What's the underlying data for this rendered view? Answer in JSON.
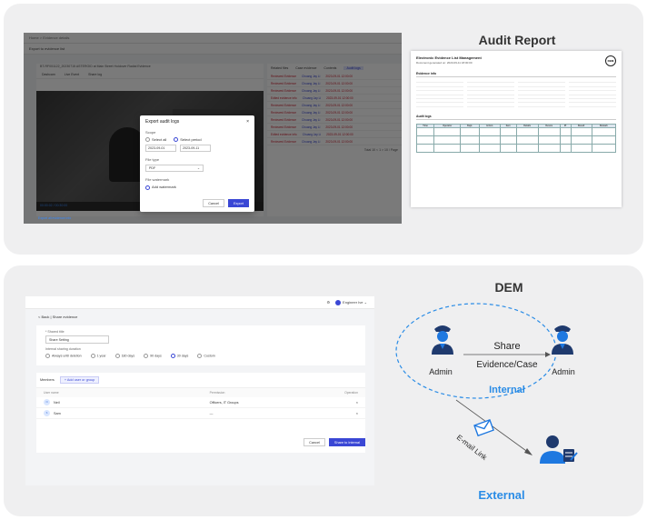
{
  "audit_app": {
    "breadcrumb": "Home > Evidence details",
    "evidence_title": "Export to evidence list",
    "evidence_line": "BT-RF001122_20230715 ASTEROID at Main Street Holdover Radial Evidence",
    "tabs": [
      "Dashcam",
      "Live Event",
      "Share log"
    ],
    "right_tabs": [
      "Related files",
      "Case evidence",
      "Contents",
      "Audit logs"
    ],
    "rows": [
      {
        "name": "Reviewed Evidence",
        "user": "Chuang Jay Li",
        "date": "2023-09-01 12:00:00"
      },
      {
        "name": "Reviewed Evidence",
        "user": "Chuang Jay Li",
        "date": "2023-09-01 12:00:00"
      },
      {
        "name": "Reviewed Evidence",
        "user": "Chuang Jay Li",
        "date": "2023-09-01 12:00:00"
      },
      {
        "name": "Edited evidence info",
        "user": "Chuang Jay Li",
        "date": "2023-09-01 12:00:00"
      },
      {
        "name": "Reviewed Evidence",
        "user": "Chuang Jay Li",
        "date": "2023-09-01 12:00:00"
      },
      {
        "name": "Reviewed Evidence",
        "user": "Chuang Jay Li",
        "date": "2023-09-01 12:00:00"
      },
      {
        "name": "Reviewed Evidence",
        "user": "Chuang Jay Li",
        "date": "2023-09-01 12:00:00"
      },
      {
        "name": "Reviewed Evidence",
        "user": "Chuang Jay Li",
        "date": "2023-09-01 12:00:00"
      },
      {
        "name": "Edited evidence info",
        "user": "Chuang Jay Li",
        "date": "2023-09-01 12:00:00"
      },
      {
        "name": "Reviewed Evidence",
        "user": "Chuang Jay Li",
        "date": "2023-09-01 12:00:00"
      }
    ],
    "pager": "Total 10  < 1 >  10 / Page",
    "video_time": "00:00:02 / 00:30:00",
    "bottom_link": "Export all evidence info",
    "modal": {
      "title": "Export audit logs",
      "close": "×",
      "scope_label": "Scope",
      "scope_options": [
        "Select all",
        "Select period"
      ],
      "date_from": "2023-09-01",
      "date_to": "2023-09-11",
      "file_type_label": "File type",
      "file_type_value": "PDF",
      "watermark_label": "File watermark",
      "watermark_option": "Add watermark",
      "cancel": "Cancel",
      "export": "Export"
    }
  },
  "report": {
    "heading": "Audit Report",
    "doc_title": "Electronic Evidence List Management",
    "doc_subtitle": "Document generated on: 2023-09-11 18:00:00",
    "logo": "DEM",
    "section1": "Evidence info",
    "section2": "Audit logs",
    "table_headers": [
      "Time",
      "Operator",
      "Dept.",
      "Action",
      "Item",
      "Details",
      "Device",
      "IP",
      "Result",
      "Remark"
    ]
  },
  "share_app": {
    "user": "Engineer Ive",
    "breadcrumb": "< Back  |  Share evidence",
    "share_title_label": "* Shared title",
    "share_title_value": "Share Setting",
    "duration_label": "Internal sharing duration",
    "duration_options": [
      "Always until deletion",
      "1 year",
      "180 days",
      "90 days",
      "30 days",
      "Custom"
    ],
    "members_tab": "Members",
    "add_button": "+ Add user or group",
    "col_user": "User name",
    "col_perm": "Permission",
    "col_op": "Operation",
    "members": [
      {
        "initial": "N",
        "name": "Neil",
        "perm": "Officers, IT Groups",
        "op": "×"
      },
      {
        "initial": "S",
        "name": "Sam",
        "perm": "—",
        "op": "×"
      }
    ],
    "cancel": "Cancel",
    "share": "Share to Internal"
  },
  "dem": {
    "heading": "DEM",
    "share_label": "Share",
    "evidence_case": "Evidence/Case",
    "admin_left": "Admin",
    "admin_right": "Admin",
    "internal": "Internal",
    "email_link": "E-mail Link",
    "external": "External",
    "colors": {
      "navy": "#1f3a6e",
      "blue": "#1e78e0",
      "accent": "#2a8ce6"
    }
  }
}
